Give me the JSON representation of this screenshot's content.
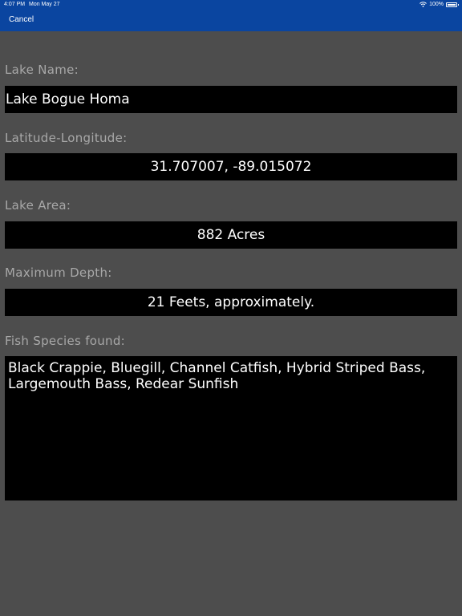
{
  "status_bar": {
    "time": "4:07 PM",
    "date": "Mon May 27",
    "battery": "100%",
    "icons": [
      "wifi-icon",
      "battery-icon"
    ]
  },
  "header": {
    "cancel_label": "Cancel",
    "color": "#0a45a0"
  },
  "form": {
    "lake_name_label": "Lake Name:",
    "lake_name_value": "Lake Bogue Homa",
    "latlong_label": "Latitude-Longitude:",
    "latlong_value": "31.707007, -89.015072",
    "area_label": "Lake Area:",
    "area_value": "882 Acres",
    "depth_label": "Maximum Depth:",
    "depth_value": "21 Feets, approximately.",
    "species_label": "Fish Species found:",
    "species_value": "Black Crappie, Bluegill, Channel Catfish, Hybrid Striped Bass, Largemouth Bass, Redear Sunfish"
  },
  "colors": {
    "background": "#4d4d4d",
    "field_background": "#000000",
    "label_text": "#a8a8a8"
  }
}
